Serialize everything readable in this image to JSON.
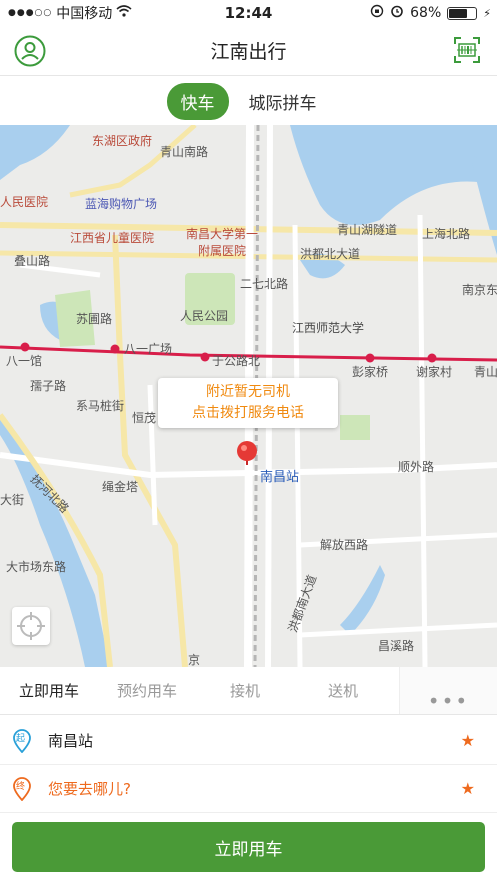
{
  "status_bar": {
    "carrier": "中国移动",
    "time": "12:44",
    "battery": "68%",
    "battery_level": 0.68
  },
  "header": {
    "title": "江南出行",
    "left_icon": "user-icon",
    "right_icon": "scan-icon"
  },
  "service_tabs": [
    {
      "label": "快车",
      "active": true
    },
    {
      "label": "城际拼车",
      "active": false
    }
  ],
  "map": {
    "labels": [
      "东湖区政府",
      "青山南路",
      "人民医院",
      "蓝海购物广场",
      "江西省儿童医院",
      "南昌大学第一",
      "附属医院",
      "青山湖隧道",
      "叠山路",
      "洪都北大道",
      "上海北路",
      "南京东",
      "人民公园",
      "二七北路",
      "江西师范大学",
      "八一馆",
      "八一广场",
      "于公路北",
      "彭家桥",
      "谢家村",
      "青山",
      "孺子路",
      "苏圃路",
      "系马桩街",
      "恒茂",
      "顺外路",
      "南昌站",
      "抚河北路",
      "绳金塔",
      "大街",
      "解放西路",
      "大市场东路",
      "洪都南大道",
      "京",
      "昌溪路"
    ],
    "popup": {
      "line1": "附近暂无司机",
      "line2": "点击拨打服务电话"
    },
    "pin_color": "#e53935",
    "metro_color": "#d81e4a"
  },
  "mode_tabs": [
    {
      "label": "立即用车",
      "active": true
    },
    {
      "label": "预约用车",
      "active": false
    },
    {
      "label": "接机",
      "active": false
    },
    {
      "label": "送机",
      "active": false
    }
  ],
  "more_icon": "more-dots-icon",
  "start": {
    "badge": "起",
    "value": "南昌站"
  },
  "destination": {
    "badge": "终",
    "placeholder": "您要去哪儿?"
  },
  "submit_label": "立即用车",
  "colors": {
    "accent": "#4a9a37",
    "orange": "#ee6a1e"
  }
}
